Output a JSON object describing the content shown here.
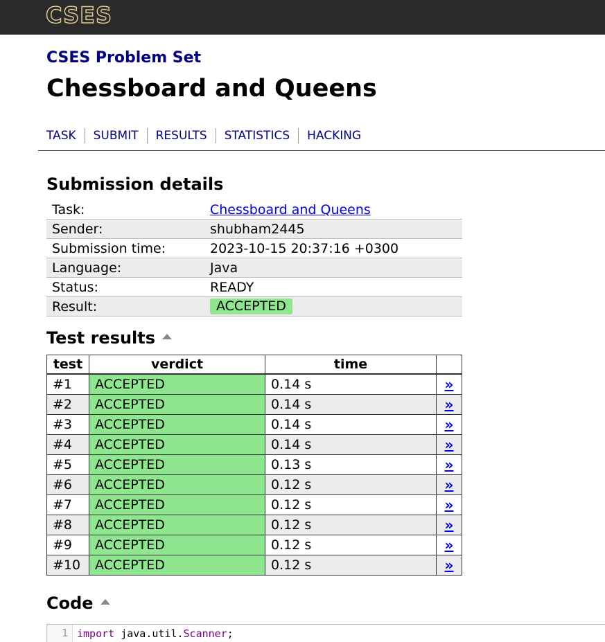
{
  "brand": {
    "logo": "CSES"
  },
  "header": {
    "subtitle": "CSES Problem Set",
    "title": "Chessboard and Queens"
  },
  "nav": [
    "TASK",
    "SUBMIT",
    "RESULTS",
    "STATISTICS",
    "HACKING"
  ],
  "details": {
    "heading": "Submission details",
    "rows": [
      {
        "key": "Task:",
        "value": "Chessboard and Queens"
      },
      {
        "key": "Sender:",
        "value": "shubham2445"
      },
      {
        "key": "Submission time:",
        "value": "2023-10-15 20:37:16 +0300"
      },
      {
        "key": "Language:",
        "value": "Java"
      },
      {
        "key": "Status:",
        "value": "READY"
      },
      {
        "key": "Result:",
        "value": "ACCEPTED"
      }
    ]
  },
  "tests": {
    "heading": "Test results",
    "columns": [
      "test",
      "verdict",
      "time",
      ""
    ],
    "arrow": "»",
    "rows": [
      {
        "test": "#1",
        "verdict": "ACCEPTED",
        "time": "0.14 s"
      },
      {
        "test": "#2",
        "verdict": "ACCEPTED",
        "time": "0.14 s"
      },
      {
        "test": "#3",
        "verdict": "ACCEPTED",
        "time": "0.14 s"
      },
      {
        "test": "#4",
        "verdict": "ACCEPTED",
        "time": "0.14 s"
      },
      {
        "test": "#5",
        "verdict": "ACCEPTED",
        "time": "0.13 s"
      },
      {
        "test": "#6",
        "verdict": "ACCEPTED",
        "time": "0.12 s"
      },
      {
        "test": "#7",
        "verdict": "ACCEPTED",
        "time": "0.12 s"
      },
      {
        "test": "#8",
        "verdict": "ACCEPTED",
        "time": "0.12 s"
      },
      {
        "test": "#9",
        "verdict": "ACCEPTED",
        "time": "0.12 s"
      },
      {
        "test": "#10",
        "verdict": "ACCEPTED",
        "time": "0.12 s"
      }
    ]
  },
  "code": {
    "heading": "Code",
    "lines": [
      {
        "num": "1",
        "keyword": "import",
        "rest": "java.util.",
        "cls": "Scanner",
        "end": ";"
      }
    ]
  },
  "colors": {
    "accepted": "#8ee68e",
    "navy": "#000080",
    "topbar": "#2a2a2a"
  }
}
